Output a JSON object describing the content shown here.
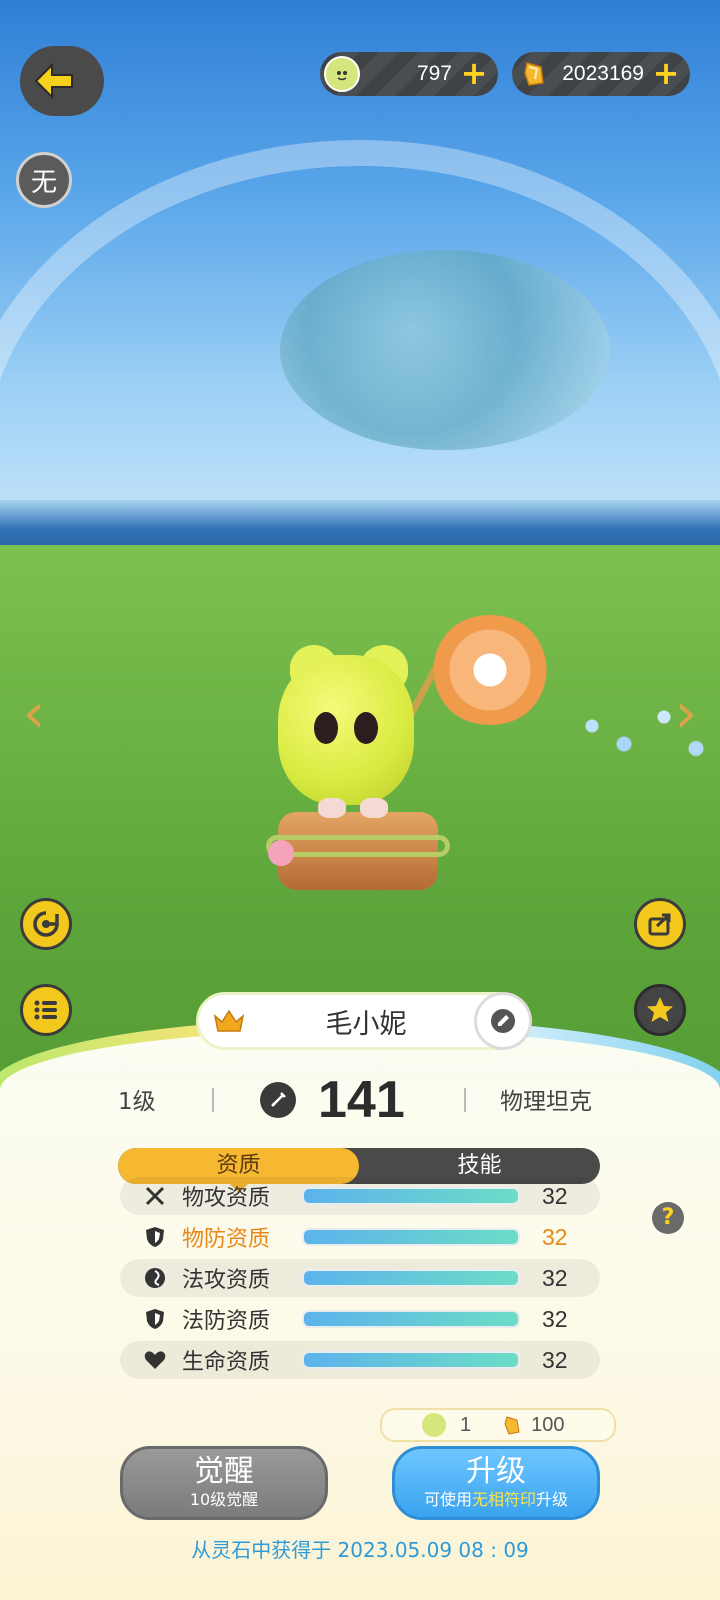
{
  "currency": {
    "coin_value": "797",
    "gem_value": "2023169",
    "coin_icon": "coin-icon",
    "gem_icon": "crystal-icon"
  },
  "badge": {
    "label": "无"
  },
  "pet": {
    "name": "毛小妮",
    "level": "1级",
    "power": "141",
    "role": "物理坦克"
  },
  "tabs": [
    {
      "label": "资质",
      "active": true
    },
    {
      "label": "技能",
      "active": false
    }
  ],
  "attributes": [
    {
      "icon": "swords-icon",
      "label": "物攻资质",
      "value": "32"
    },
    {
      "icon": "shield-icon",
      "label": "物防资质",
      "value": "32",
      "highlight": true
    },
    {
      "icon": "magic-swirl-icon",
      "label": "法攻资质",
      "value": "32"
    },
    {
      "icon": "shield-icon",
      "label": "法防资质",
      "value": "32"
    },
    {
      "icon": "heart-icon",
      "label": "生命资质",
      "value": "32"
    }
  ],
  "cost": {
    "coin": "1",
    "gem": "100"
  },
  "buttons": {
    "awaken_title": "觉醒",
    "awaken_sub": "10级觉醒",
    "upgrade_title": "升级",
    "upgrade_sub_pre": "可使用",
    "upgrade_sub_hl": "无相符印",
    "upgrade_sub_post": "升级"
  },
  "origin": "从灵石中获得于 2023.05.09   08 : 09",
  "colors": {
    "accent_yellow": "#f6b830",
    "bar_start": "#5cb3ec",
    "bar_end": "#6ddcc6",
    "upgrade_blue": "#3aa3ef",
    "highlight_orange": "#e7881a"
  }
}
